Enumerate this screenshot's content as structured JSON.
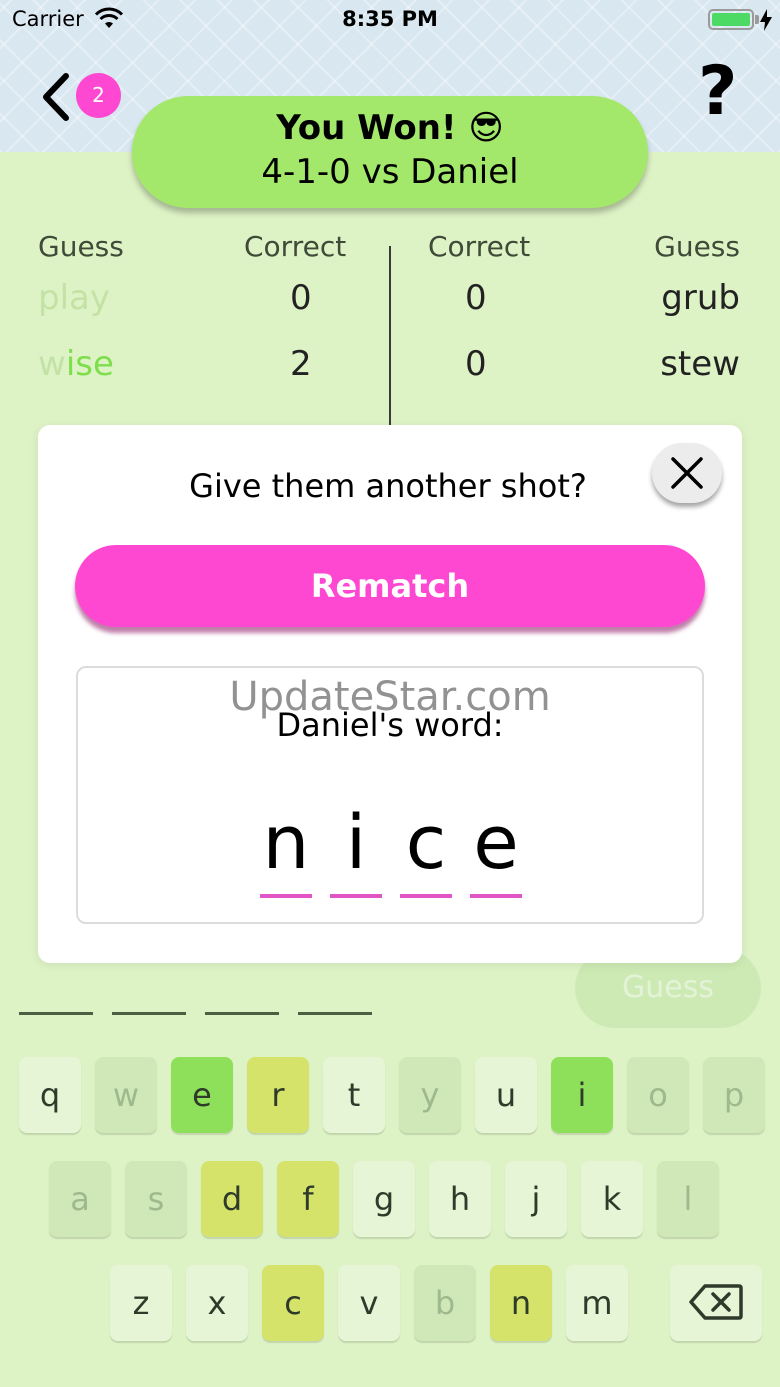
{
  "status_bar": {
    "carrier": "Carrier",
    "time": "8:35 PM"
  },
  "header": {
    "badge_count": "2",
    "help_label": "?"
  },
  "result": {
    "title": "You Won! 😎",
    "subtitle": "4-1-0 vs Daniel"
  },
  "board": {
    "headers": {
      "left_guess": "Guess",
      "left_correct": "Correct",
      "right_correct": "Correct",
      "right_guess": "Guess"
    },
    "left_rows": [
      {
        "guess": "play",
        "correct": "0"
      },
      {
        "guess": "wise",
        "correct": "2"
      }
    ],
    "right_rows": [
      {
        "correct": "0",
        "guess": "grub"
      },
      {
        "correct": "0",
        "guess": "stew"
      }
    ]
  },
  "modal": {
    "question": "Give them another shot?",
    "rematch_label": "Rematch",
    "watermark": "UpdateStar.com",
    "word_label": "Daniel's word:",
    "word_letters": [
      "n",
      "i",
      "c",
      "e"
    ]
  },
  "guess_button_label": "Guess",
  "keyboard": {
    "rows": [
      [
        {
          "k": "q",
          "s": "normal"
        },
        {
          "k": "w",
          "s": "used"
        },
        {
          "k": "e",
          "s": "correct"
        },
        {
          "k": "r",
          "s": "present"
        },
        {
          "k": "t",
          "s": "normal"
        },
        {
          "k": "y",
          "s": "used"
        },
        {
          "k": "u",
          "s": "normal"
        },
        {
          "k": "i",
          "s": "correct"
        },
        {
          "k": "o",
          "s": "used"
        },
        {
          "k": "p",
          "s": "used"
        }
      ],
      [
        {
          "k": "a",
          "s": "used"
        },
        {
          "k": "s",
          "s": "used"
        },
        {
          "k": "d",
          "s": "present"
        },
        {
          "k": "f",
          "s": "present"
        },
        {
          "k": "g",
          "s": "normal"
        },
        {
          "k": "h",
          "s": "normal"
        },
        {
          "k": "j",
          "s": "normal"
        },
        {
          "k": "k",
          "s": "normal"
        },
        {
          "k": "l",
          "s": "used"
        }
      ],
      [
        {
          "k": "z",
          "s": "normal"
        },
        {
          "k": "x",
          "s": "normal"
        },
        {
          "k": "c",
          "s": "present"
        },
        {
          "k": "v",
          "s": "normal"
        },
        {
          "k": "b",
          "s": "used"
        },
        {
          "k": "n",
          "s": "present"
        },
        {
          "k": "m",
          "s": "normal"
        }
      ]
    ],
    "delete_icon": "backspace-icon"
  },
  "colors": {
    "accent_pink": "#ff48d2",
    "win_green": "#a3e86a",
    "correct_key": "#8ee05a",
    "present_key": "#d5e36a",
    "background": "#ddf3c5"
  }
}
